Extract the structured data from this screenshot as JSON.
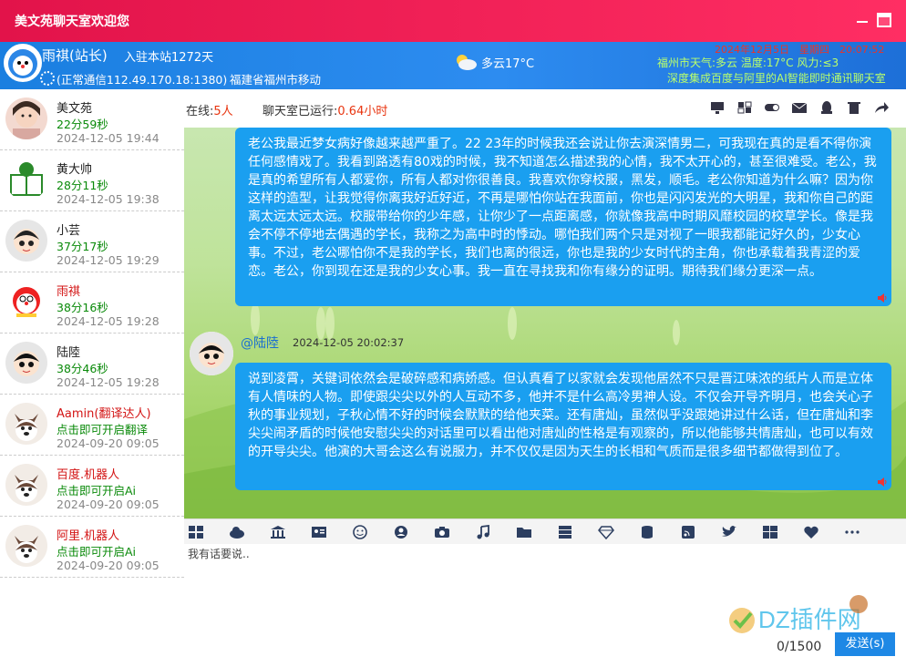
{
  "window": {
    "title": "美文苑聊天室欢迎您"
  },
  "header": {
    "username": "雨祺(站长)",
    "stay": "入驻本站1272天",
    "connection": "(正常通信112.49.170.18:1380)",
    "location": "福建省福州市移动",
    "weather_text": "多云17°C",
    "date_text": "2024年12月5日　星期四　20:07:52",
    "weather_ticker": "福州市天气:多云 温度:17°C 风力:≤3",
    "ads_ticker": "深度集成百度与阿里的AI智能即时通讯聊天室"
  },
  "status": {
    "online_label": "在线:",
    "online_count": "5人",
    "runtime_label": "聊天室已运行:",
    "runtime_value": "0.64小时"
  },
  "users": [
    {
      "name": "美文苑",
      "duration": "22分59秒",
      "time": "2024-12-05 19:44",
      "avatar": "girl-photo"
    },
    {
      "name": "黄大帅",
      "duration": "28分11秒",
      "time": "2024-12-05 19:38",
      "avatar": "reading-avatar"
    },
    {
      "name": "小芸",
      "duration": "37分17秒",
      "time": "2024-12-05 19:29",
      "avatar": "cartoon-girl"
    },
    {
      "name": "雨祺",
      "duration": "38分16秒",
      "time": "2024-12-05 19:28",
      "avatar": "doraemon"
    },
    {
      "name": "陆陸",
      "duration": "38分46秒",
      "time": "2024-12-05 19:28",
      "avatar": "cartoon-boy"
    },
    {
      "name": "Aamin(翻译达人)",
      "duration": "点击即可开启翻译",
      "time": "2024-09-20 09:05",
      "avatar": "husky"
    },
    {
      "name": "百度.机器人",
      "duration": "点击即可开启Ai",
      "time": "2024-09-20 09:05",
      "avatar": "husky"
    },
    {
      "name": "阿里.机器人",
      "duration": "点击即可开启Ai",
      "time": "2024-09-20 09:05",
      "avatar": "husky"
    }
  ],
  "messages": [
    {
      "text": "老公我最近梦女病好像越来越严重了。22 23年的时候我还会说让你去演深情男二，可我现在真的是看不得你演任何感情戏了。我看到路透有80戏的时候，我不知道怎么描述我的心情，我不太开心的，甚至很难受。老公，我是真的希望所有人都爱你，所有人都对你很善良。我喜欢你穿校服，黑发，顺毛。老公你知道为什么嘛？因为你这样的造型，让我觉得你离我好近好近，不再是哪怕你站在我面前，你也是闪闪发光的大明星，我和你自己的距离太远太远太远。校服带给你的少年感，让你少了一点距离感，你就像我高中时期风靡校园的校草学长。像是我会不停不停地去偶遇的学长，我称之为高中时的悸动。哪怕我们两个只是对视了一眼我都能记好久的，少女心事。不过，老公哪怕你不是我的学长，我们也离的很远，你也是我的少女时代的主角，你也承载着我青涩的爱恋。老公，你到现在还是我的少女心事。我一直在寻找我和你有缘分的证明。期待我们缘分更深一点。"
    },
    {
      "sender": "@陆陸",
      "time": "2024-12-05 20:02:37",
      "text": "说到凌霄，关键词依然会是破碎感和病娇感。但认真看了以家就会发现他居然不只是晋江味浓的纸片人而是立体有人情味的人物。即使跟尖尖以外的人互动不多，他并不是什么高冷男神人设。不仅会开导齐明月，也会关心子秋的事业规划，子秋心情不好的时候会默默的给他夹菜。还有唐灿，虽然似乎没跟她讲过什么话，但在唐灿和李尖尖闹矛盾的时候他安慰尖尖的对话里可以看出他对唐灿的性格是有观察的，所以他能够共情唐灿，也可以有效的开导尖尖。他演的大哥会这么有说服力，并不仅仅是因为天生的长相和气质而是很多细节都做得到位了。"
    }
  ],
  "input": {
    "placeholder": "我有话要说..",
    "counter": "0/1500",
    "send_label": "发送(s)"
  },
  "watermark": {
    "text": "DZ插件网"
  },
  "colors": {
    "title_red": "#e2134a",
    "header_blue": "#1a7fe0",
    "bubble_blue": "#1a9ff0"
  }
}
